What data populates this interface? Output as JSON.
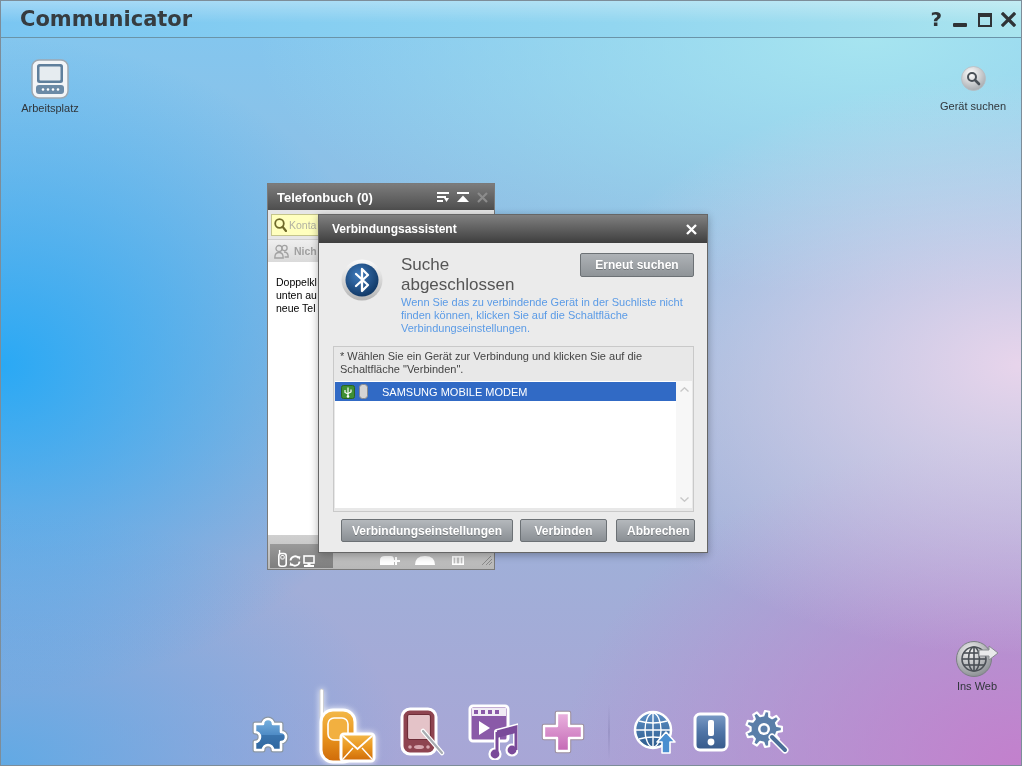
{
  "window": {
    "title": "Communicator",
    "help": "?"
  },
  "desktop_icons": [
    {
      "kind": "computer",
      "label": "Arbeitsplatz"
    },
    {
      "kind": "search",
      "label": "Gerät suchen"
    },
    {
      "kind": "globe",
      "label": "Ins Web"
    }
  ],
  "phonebook": {
    "title": "Telefonbuch (0)",
    "close_disabled": true,
    "search": {
      "placeholder": "Konta"
    },
    "group_label": "Nich",
    "hint_lines": [
      "Doppelkl",
      "unten au",
      "neue Tel"
    ]
  },
  "dialog": {
    "title": "Verbindungsassistent",
    "heading": "Suche abgeschlossen",
    "search_again_button": "Erneut suchen",
    "info": "Wenn Sie das zu verbindende Gerät in der Suchliste nicht finden können, klicken Sie auf die Schaltfläche Verbindungseinstellungen.",
    "instruction": "* Wählen Sie ein Gerät zur Verbindung und klicken Sie auf die Schaltfläche \"Verbinden\".",
    "devices": [
      {
        "name": "SAMSUNG MOBILE MODEM",
        "selected": true
      }
    ],
    "buttons": [
      "Verbindungseinstellungen",
      "Verbinden",
      "Abbrechen"
    ]
  },
  "dock": {
    "groups": [
      {
        "items": [
          {
            "kind": "puzzle",
            "selected": false
          },
          {
            "kind": "phone_mail",
            "selected": true
          },
          {
            "kind": "pda",
            "selected": false
          },
          {
            "kind": "media",
            "selected": false
          },
          {
            "kind": "plus",
            "selected": false
          }
        ]
      },
      {
        "items": [
          {
            "kind": "globe_upload",
            "selected": false
          },
          {
            "kind": "alert",
            "selected": false
          },
          {
            "kind": "settings",
            "selected": false
          }
        ]
      }
    ]
  }
}
